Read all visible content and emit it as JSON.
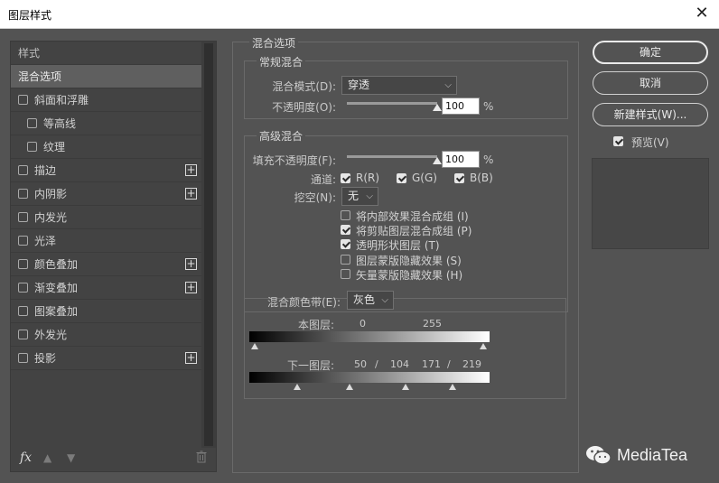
{
  "window": {
    "title": "图层样式"
  },
  "styles_panel": {
    "header": "样式",
    "items": [
      {
        "label": "混合选项",
        "selected": true,
        "checkbox": false,
        "level": 0,
        "plus": false
      },
      {
        "label": "斜面和浮雕",
        "checkbox": true,
        "level": 0,
        "plus": false
      },
      {
        "label": "等高线",
        "checkbox": true,
        "level": 1,
        "plus": false
      },
      {
        "label": "纹理",
        "checkbox": true,
        "level": 1,
        "plus": false
      },
      {
        "label": "描边",
        "checkbox": true,
        "level": 0,
        "plus": true
      },
      {
        "label": "内阴影",
        "checkbox": true,
        "level": 0,
        "plus": true
      },
      {
        "label": "内发光",
        "checkbox": true,
        "level": 0,
        "plus": false
      },
      {
        "label": "光泽",
        "checkbox": true,
        "level": 0,
        "plus": false
      },
      {
        "label": "颜色叠加",
        "checkbox": true,
        "level": 0,
        "plus": true
      },
      {
        "label": "渐变叠加",
        "checkbox": true,
        "level": 0,
        "plus": true
      },
      {
        "label": "图案叠加",
        "checkbox": true,
        "level": 0,
        "plus": false
      },
      {
        "label": "外发光",
        "checkbox": true,
        "level": 0,
        "plus": false
      },
      {
        "label": "投影",
        "checkbox": true,
        "level": 0,
        "plus": true
      }
    ],
    "footer": {
      "fx": "fx"
    }
  },
  "blend_options": {
    "title": "混合选项",
    "general": {
      "title": "常规混合",
      "mode_label": "混合模式(D):",
      "mode_value": "穿透",
      "opacity_label": "不透明度(O):",
      "opacity_value": "100",
      "opacity_level": 1.0,
      "percent": "%"
    },
    "advanced": {
      "title": "高级混合",
      "fill_label": "填充不透明度(F):",
      "fill_value": "100",
      "fill_level": 1.0,
      "percent": "%",
      "channels_label": "通道:",
      "channels": [
        {
          "label": "R(R)",
          "checked": true
        },
        {
          "label": "G(G)",
          "checked": true
        },
        {
          "label": "B(B)",
          "checked": true
        }
      ],
      "knockout_label": "挖空(N):",
      "knockout_value": "无",
      "options": [
        {
          "label": "将内部效果混合成组 (I)",
          "checked": false
        },
        {
          "label": "将剪贴图层混合成组 (P)",
          "checked": true
        },
        {
          "label": "透明形状图层 (T)",
          "checked": true
        },
        {
          "label": "图层蒙版隐藏效果 (S)",
          "checked": false
        },
        {
          "label": "矢量蒙版隐藏效果 (H)",
          "checked": false
        }
      ]
    },
    "blend_if": {
      "label": "混合颜色带(E):",
      "value": "灰色",
      "this_layer_label": "本图层:",
      "this_layer_values": [
        "0",
        "255"
      ],
      "underlying_label": "下一图层:",
      "underlying_values": [
        "50",
        "/",
        "104",
        "171",
        "/",
        "219"
      ]
    }
  },
  "buttons": {
    "ok": "确定",
    "cancel": "取消",
    "new_style": "新建样式(W)...",
    "preview_label": "预览(V)",
    "preview_checked": true
  },
  "watermark": {
    "text": "MediaTea"
  },
  "colors": {
    "dialog_bg": "#535353",
    "panel_bg": "#434343",
    "selected_row": "#5f5f5f"
  }
}
